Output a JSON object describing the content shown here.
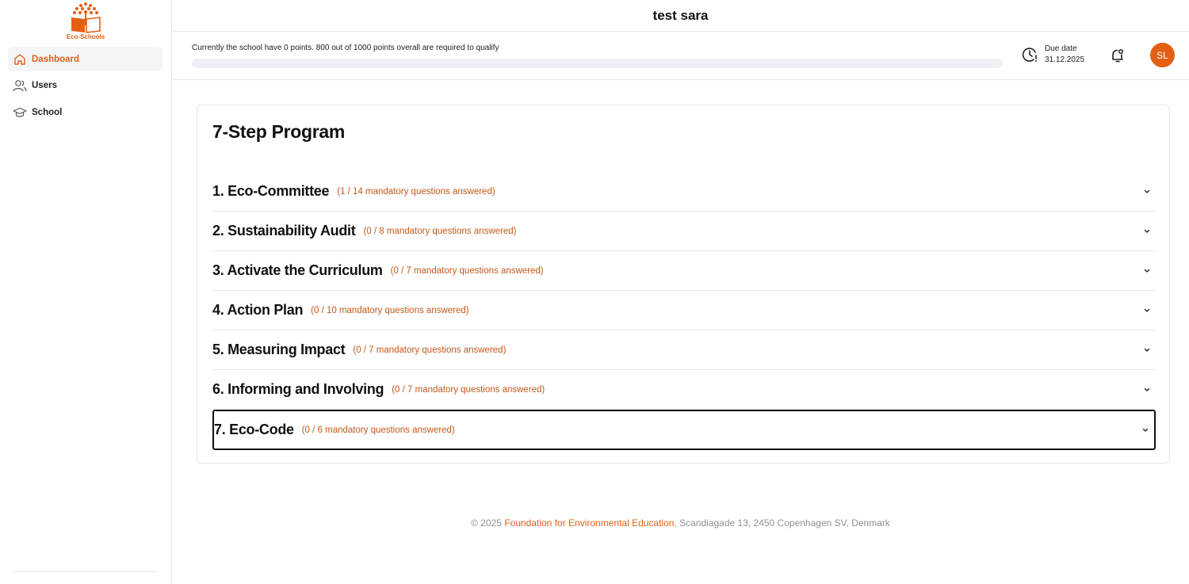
{
  "sidebar": {
    "logo_text": "Eco-Schools",
    "items": [
      {
        "label": "Dashboard",
        "icon": "home-icon",
        "active": true
      },
      {
        "label": "Users",
        "icon": "users-icon",
        "active": false
      },
      {
        "label": "School",
        "icon": "graduation-cap-icon",
        "active": false
      }
    ]
  },
  "header": {
    "title": "test sara"
  },
  "progress": {
    "text": "Currently the school have 0 points. 800 out of 1000 points overall are required to qualify",
    "fraction": 0,
    "due_label": "Due date",
    "due_value": "31.12.2025",
    "avatar_initials": "SL"
  },
  "program": {
    "title": "7-Step Program",
    "steps": [
      {
        "title": "1. Eco-Committee",
        "count": "(1 / 14 mandatory questions answered)"
      },
      {
        "title": "2. Sustainability Audit",
        "count": "(0 / 8 mandatory questions answered)"
      },
      {
        "title": "3. Activate the Curriculum",
        "count": "(0 / 7 mandatory questions answered)"
      },
      {
        "title": "4. Action Plan",
        "count": "(0 / 10 mandatory questions answered)"
      },
      {
        "title": "5. Measuring Impact",
        "count": "(0 / 7 mandatory questions answered)"
      },
      {
        "title": "6. Informing and Involving",
        "count": "(0 / 7 mandatory questions answered)"
      },
      {
        "title": "7. Eco-Code",
        "count": "(0 / 6 mandatory questions answered)"
      }
    ]
  },
  "footer": {
    "prefix": "© 2025 ",
    "org": "Foundation for Environmental Education",
    "suffix": ", Scandiagade 13, 2450 Copenhagen SV, Denmark"
  },
  "colors": {
    "accent": "#e35f14",
    "count_text": "#c2581a"
  }
}
